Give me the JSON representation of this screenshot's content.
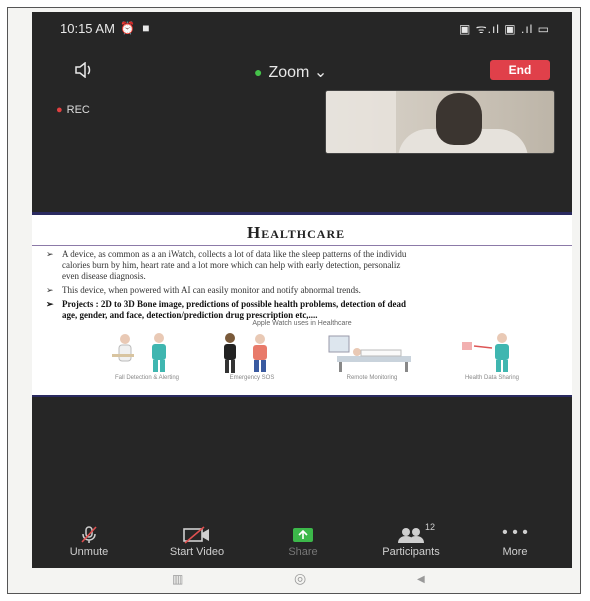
{
  "status_bar": {
    "time": "10:15 AM",
    "left_icons": "⏰ ■",
    "right_icons": "▣ ᯤ.ıl ▣ .ıl ▭"
  },
  "meeting": {
    "title": "Zoom ⌄",
    "end_label": "End",
    "rec_label": "REC"
  },
  "slide": {
    "title": "Healthcare",
    "bullets": [
      {
        "lines": [
          "A device, as common as a an iWatch, collects a lot of data like the sleep patterns of the individu",
          "calories burn by him, heart rate and a lot more which can help with early detection, personaliz",
          "even disease diagnosis."
        ]
      },
      {
        "lines": [
          "This device, when powered with AI can easily monitor and notify abnormal trends."
        ]
      },
      {
        "lines": [
          "Projects : 2D to 3D Bone image, predictions of possible health problems, detection of dead",
          "age, gender, and face, detection/prediction drug prescription etc,...."
        ]
      }
    ],
    "caption_center": "Apple Watch uses in Healthcare",
    "captions": [
      "Fall Detection & Alerting",
      "Emergency SOS",
      "Remote Monitoring",
      "Health Data Sharing"
    ]
  },
  "toolbar": {
    "items": [
      {
        "label": "Unmute",
        "icon": "mic-muted-icon"
      },
      {
        "label": "Start Video",
        "icon": "video-off-icon"
      },
      {
        "label": "Share",
        "icon": "share-icon"
      },
      {
        "label": "Participants",
        "icon": "participants-icon",
        "badge": "12"
      },
      {
        "label": "More",
        "icon": "more-icon"
      }
    ]
  },
  "nav": {
    "recent": "▥",
    "home": "◎",
    "back": "◀"
  }
}
